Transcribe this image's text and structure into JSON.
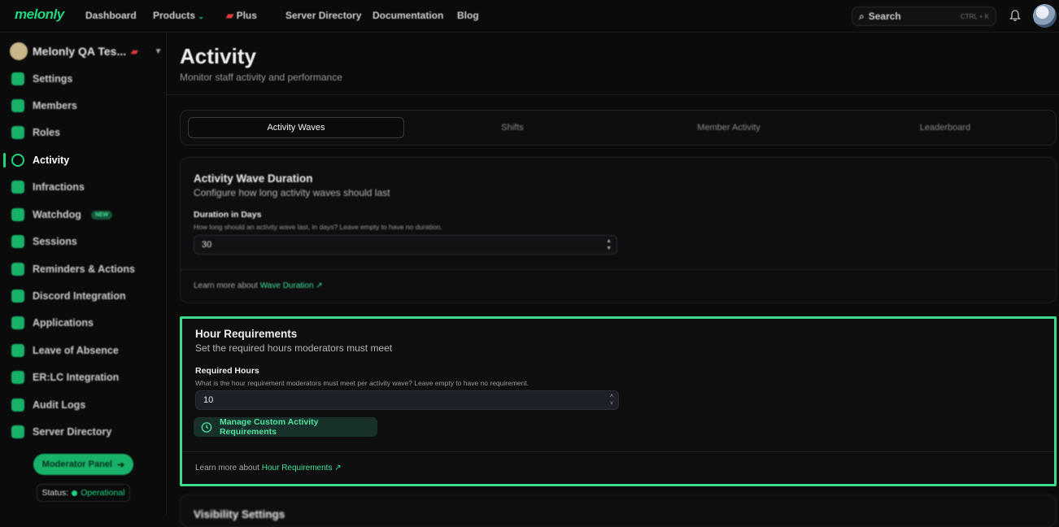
{
  "brand": {
    "logo": "melonly",
    "accent": "#1fd67e"
  },
  "topnav": {
    "items": [
      "Dashboard",
      "Products",
      "Plus",
      "Server Directory",
      "Documentation",
      "Blog"
    ],
    "search_label": "Search",
    "search_shortcut": "CTRL + K"
  },
  "sidebar": {
    "server_name": "Melonly QA Tes...",
    "items": [
      {
        "label": "Settings",
        "icon": "gear-icon"
      },
      {
        "label": "Members",
        "icon": "users-icon"
      },
      {
        "label": "Roles",
        "icon": "roles-icon"
      },
      {
        "label": "Activity",
        "icon": "clock-icon"
      },
      {
        "label": "Infractions",
        "icon": "gavel-icon"
      },
      {
        "label": "Watchdog",
        "icon": "eye-icon",
        "badge": "NEW"
      },
      {
        "label": "Sessions",
        "icon": "monitor-icon"
      },
      {
        "label": "Reminders & Actions",
        "icon": "bell-icon"
      },
      {
        "label": "Discord Integration",
        "icon": "discord-icon"
      },
      {
        "label": "Applications",
        "icon": "clipboard-icon"
      },
      {
        "label": "Leave of Absence",
        "icon": "calendar-icon"
      },
      {
        "label": "ER:LC Integration",
        "icon": "car-icon"
      },
      {
        "label": "Audit Logs",
        "icon": "file-icon"
      },
      {
        "label": "Server Directory",
        "icon": "compass-icon"
      }
    ],
    "active_item": "Activity",
    "moderator_panel": "Moderator Panel",
    "status_label": "Status:",
    "status_value": "Operational"
  },
  "page": {
    "title": "Activity",
    "subtitle": "Monitor staff activity and performance"
  },
  "tabs": [
    "Activity Waves",
    "Shifts",
    "Member Activity",
    "Leaderboard"
  ],
  "active_tab": "Activity Waves",
  "wave_duration": {
    "title": "Activity Wave Duration",
    "subtitle": "Configure how long activity waves should last",
    "field_label": "Duration in Days",
    "field_help": "How long should an activity wave last, in days? Leave empty to have no duration.",
    "value": "30",
    "learn_prefix": "Learn more about",
    "learn_link": "Wave Duration"
  },
  "hour_requirements": {
    "title": "Hour Requirements",
    "subtitle": "Set the required hours moderators must meet",
    "field_label": "Required Hours",
    "field_help": "What is the hour requirement moderators must meet per activity wave? Leave empty to have no requirement.",
    "value": "10",
    "custom_button": "Manage Custom Activity Requirements",
    "learn_prefix": "Learn more about",
    "learn_link": "Hour Requirements"
  },
  "visibility": {
    "title": "Visibility Settings"
  }
}
